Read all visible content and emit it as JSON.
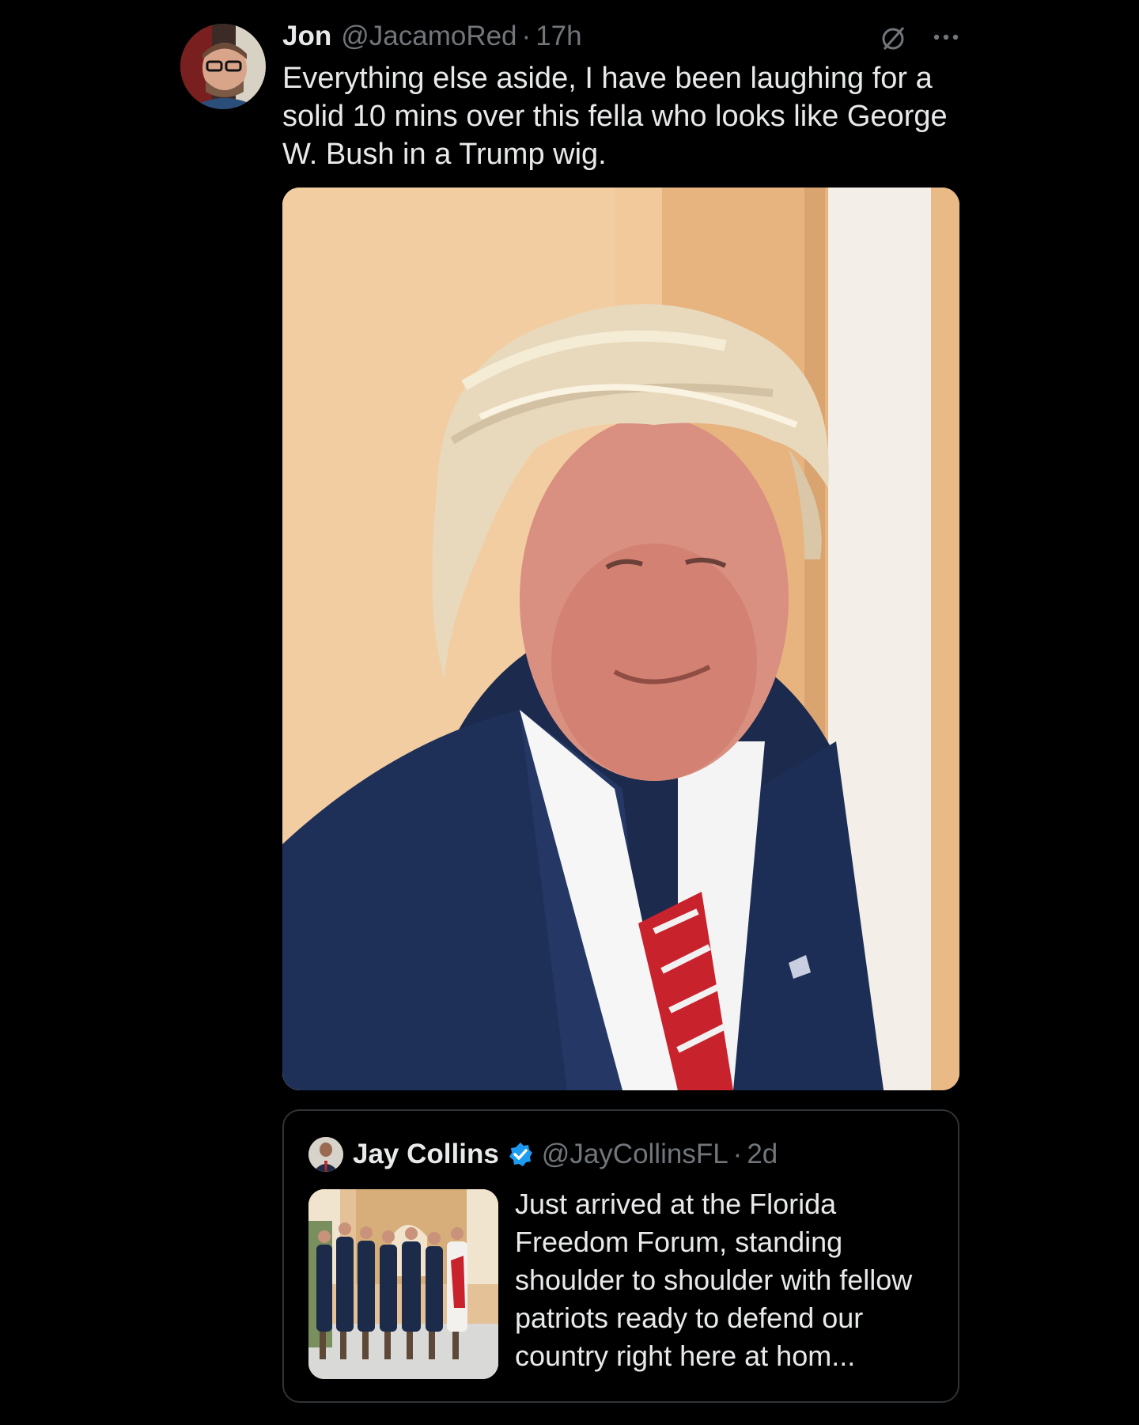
{
  "tweet": {
    "author_name": "Jon",
    "author_handle": "@JacamoRed",
    "separator": "·",
    "time": "17h",
    "text": "Everything else aside, I have been laughing for a solid 10 mins over this fella who looks like George W. Bush in a Trump wig.",
    "icons": {
      "grok": "grok-slash-circle-icon",
      "more": "more-dots-icon"
    }
  },
  "quote": {
    "author_name": "Jay Collins",
    "author_handle": "@JayCollinsFL",
    "separator": "·",
    "time": "2d",
    "text": "Just arrived at the Florida Freedom Forum, standing shoulder to shoulder with fellow patriots ready to defend our country right here at hom...",
    "verified": true
  },
  "colors": {
    "background": "#000000",
    "text": "#e7e9ea",
    "muted": "#71767b",
    "border": "#2f3336",
    "verified": "#1d9bf0"
  }
}
